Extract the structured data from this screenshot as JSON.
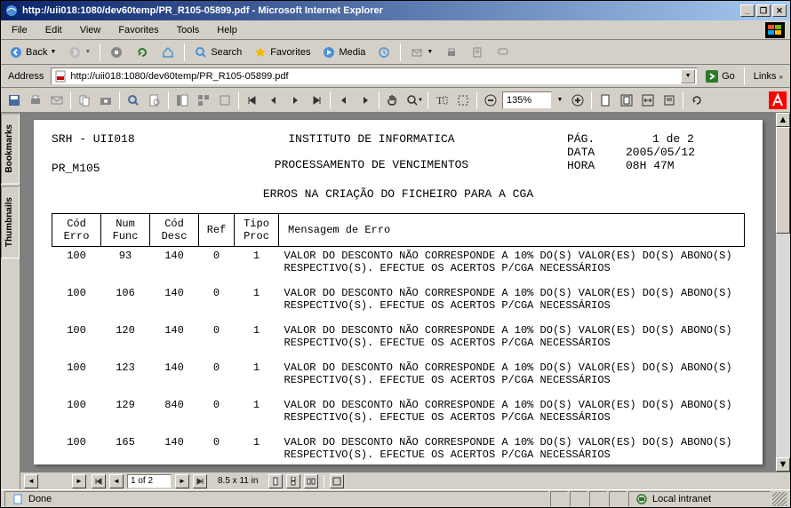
{
  "window": {
    "title": "http://uii018:1080/dev60temp/PR_R105-05899.pdf - Microsoft Internet Explorer"
  },
  "menu": {
    "file": "File",
    "edit": "Edit",
    "view": "View",
    "favorites": "Favorites",
    "tools": "Tools",
    "help": "Help"
  },
  "toolbar": {
    "back": "Back",
    "search": "Search",
    "favorites": "Favorites",
    "media": "Media"
  },
  "address": {
    "label": "Address",
    "url": "http://uii018:1080/dev60temp/PR_R105-05899.pdf",
    "go": "Go",
    "links": "Links"
  },
  "pdf_toolbar": {
    "zoom": "135%"
  },
  "pdf_footer": {
    "page_input": "1 of 2",
    "page_size": "8.5 x 11 in"
  },
  "doc": {
    "srh": "SRH - UII018",
    "org": "INSTITUTO DE INFORMATICA",
    "report_code": "PR_M105",
    "process_title": "PROCESSAMENTO DE VENCIMENTOS",
    "report_title": "ERROS NA CRIAÇÃO DO FICHEIRO PARA A CGA",
    "meta": {
      "page_label": "PÁG.",
      "page_value": "1 de 2",
      "date_label": "DATA",
      "date_value": "2005/05/12",
      "time_label": "HORA",
      "time_value": "08H 47M"
    },
    "headers": {
      "cod_erro": "Cód Erro",
      "num_func": "Num Func",
      "cod_desc": "Cód Desc",
      "ref": "Ref",
      "tipo_proc": "Tipo Proc",
      "mensagem": "Mensagem de Erro"
    },
    "rows": [
      {
        "cod_erro": "100",
        "num_func": "93",
        "cod_desc": "140",
        "ref": "0",
        "tipo_proc": "1",
        "msg": "VALOR DO DESCONTO NÃO CORRESPONDE A 10% DO(S) VALOR(ES) DO(S) ABONO(S) RESPECTIVO(S). EFECTUE OS ACERTOS P/CGA NECESSÁRIOS"
      },
      {
        "cod_erro": "100",
        "num_func": "106",
        "cod_desc": "140",
        "ref": "0",
        "tipo_proc": "1",
        "msg": "VALOR DO DESCONTO NÃO CORRESPONDE A 10% DO(S) VALOR(ES) DO(S) ABONO(S) RESPECTIVO(S). EFECTUE OS ACERTOS P/CGA NECESSÁRIOS"
      },
      {
        "cod_erro": "100",
        "num_func": "120",
        "cod_desc": "140",
        "ref": "0",
        "tipo_proc": "1",
        "msg": "VALOR DO DESCONTO NÃO CORRESPONDE A 10% DO(S) VALOR(ES) DO(S) ABONO(S) RESPECTIVO(S). EFECTUE OS ACERTOS P/CGA NECESSÁRIOS"
      },
      {
        "cod_erro": "100",
        "num_func": "123",
        "cod_desc": "140",
        "ref": "0",
        "tipo_proc": "1",
        "msg": "VALOR DO DESCONTO NÃO CORRESPONDE A 10% DO(S) VALOR(ES) DO(S) ABONO(S) RESPECTIVO(S). EFECTUE OS ACERTOS P/CGA NECESSÁRIOS"
      },
      {
        "cod_erro": "100",
        "num_func": "129",
        "cod_desc": "840",
        "ref": "0",
        "tipo_proc": "1",
        "msg": "VALOR DO DESCONTO NÃO CORRESPONDE A 10% DO(S) VALOR(ES) DO(S) ABONO(S) RESPECTIVO(S). EFECTUE OS ACERTOS P/CGA NECESSÁRIOS"
      },
      {
        "cod_erro": "100",
        "num_func": "165",
        "cod_desc": "140",
        "ref": "0",
        "tipo_proc": "1",
        "msg": "VALOR DO DESCONTO NÃO CORRESPONDE A 10% DO(S) VALOR(ES) DO(S) ABONO(S) RESPECTIVO(S). EFECTUE OS ACERTOS P/CGA NECESSÁRIOS"
      }
    ]
  },
  "status": {
    "text": "Done",
    "zone": "Local intranet"
  }
}
